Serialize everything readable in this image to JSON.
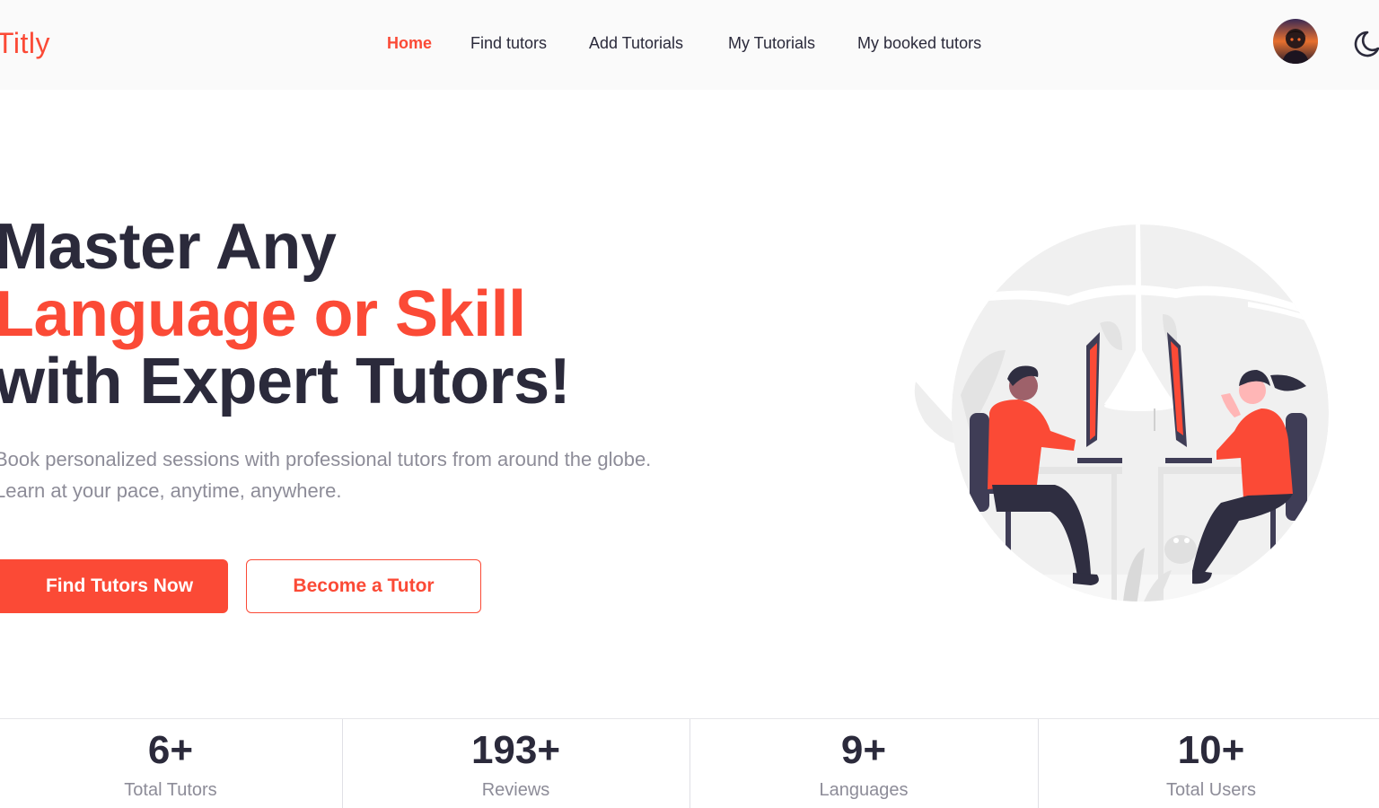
{
  "brand": {
    "logo": "Titly",
    "accent_color": "#fb4a36",
    "text_color": "#2b2a3b"
  },
  "nav": {
    "items": [
      {
        "label": "Home",
        "active": true
      },
      {
        "label": "Find tutors",
        "active": false
      },
      {
        "label": "Add Tutorials",
        "active": false
      },
      {
        "label": "My Tutorials",
        "active": false
      },
      {
        "label": "My booked tutors",
        "active": false
      }
    ],
    "avatar_icon": "user-avatar",
    "theme_toggle_icon": "moon-icon"
  },
  "hero": {
    "title_line1": "Master Any",
    "title_line2": "Language or Skill",
    "title_line3": "with Expert Tutors!",
    "subtitle_line1": "Book personalized sessions with professional tutors from around the globe.",
    "subtitle_line2": "Learn at your pace, anytime, anywhere.",
    "primary_button": "Find Tutors Now",
    "secondary_button": "Become a Tutor",
    "illustration_icon": "two-people-at-computers-illustration"
  },
  "stats": [
    {
      "value": "6+",
      "label": "Total Tutors"
    },
    {
      "value": "193+",
      "label": "Reviews"
    },
    {
      "value": "9+",
      "label": "Languages"
    },
    {
      "value": "10+",
      "label": "Total Users"
    }
  ]
}
